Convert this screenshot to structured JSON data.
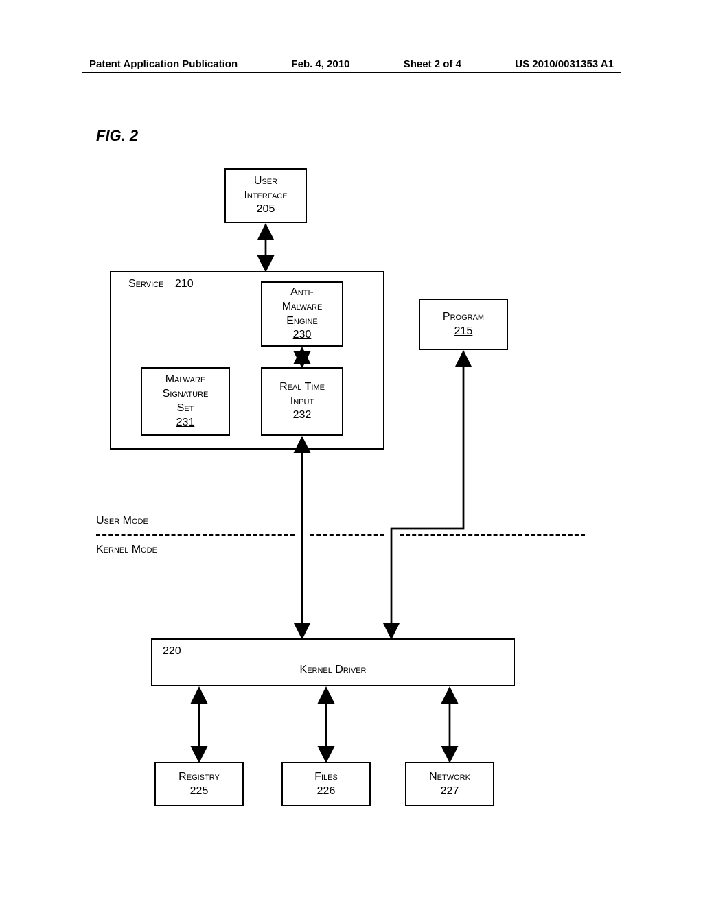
{
  "header": {
    "title": "Patent Application Publication",
    "date": "Feb. 4, 2010",
    "sheet": "Sheet 2 of 4",
    "docnum": "US 2010/0031353 A1"
  },
  "figure": "FIG. 2",
  "boxes": {
    "ui": {
      "label": "User Interface",
      "num": "205"
    },
    "service": {
      "label": "Service",
      "num": "210"
    },
    "engine": {
      "label": "Anti-Malware Engine",
      "num": "230"
    },
    "sigset": {
      "label": "Malware Signature Set",
      "num": "231"
    },
    "rti": {
      "label": "Real Time Input",
      "num": "232"
    },
    "program": {
      "label": "Program",
      "num": "215"
    },
    "driver": {
      "label": "Kernel Driver",
      "num": "220"
    },
    "registry": {
      "label": "Registry",
      "num": "225"
    },
    "files": {
      "label": "Files",
      "num": "226"
    },
    "network": {
      "label": "Network",
      "num": "227"
    }
  },
  "modes": {
    "user": "User Mode",
    "kernel": "Kernel Mode"
  }
}
